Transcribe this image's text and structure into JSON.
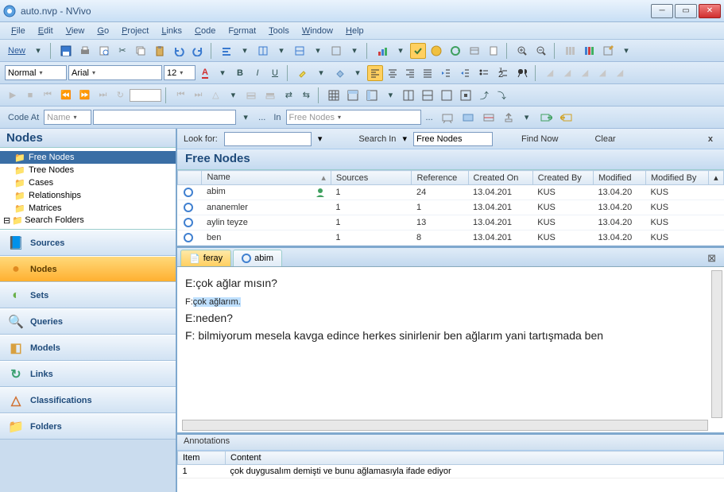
{
  "window": {
    "title": "auto.nvp - NVivo"
  },
  "menu": [
    "File",
    "Edit",
    "View",
    "Go",
    "Project",
    "Links",
    "Code",
    "Format",
    "Tools",
    "Window",
    "Help"
  ],
  "toolbar1": {
    "new": "New"
  },
  "toolbar2": {
    "style": "Normal",
    "font": "Arial",
    "size": "12"
  },
  "codebar": {
    "codeat": "Code At",
    "name": "Name",
    "in": "In",
    "freenodes": "Free Nodes",
    "ellipsis": "..."
  },
  "nav": {
    "header": "Nodes",
    "tree": [
      {
        "label": "Free Nodes",
        "sel": true
      },
      {
        "label": "Tree Nodes"
      },
      {
        "label": "Cases"
      },
      {
        "label": "Relationships"
      },
      {
        "label": "Matrices"
      },
      {
        "label": "Search Folders",
        "exp": true
      }
    ],
    "buttons": [
      {
        "label": "Sources",
        "icon": "📘",
        "c": "#3A7ACF"
      },
      {
        "label": "Nodes",
        "icon": "●",
        "active": true,
        "c": "#E08A20"
      },
      {
        "label": "Sets",
        "icon": "◐",
        "c": "#6AB04A"
      },
      {
        "label": "Queries",
        "icon": "🔍",
        "c": "#3A7ACF"
      },
      {
        "label": "Models",
        "icon": "◧",
        "c": "#D8A040"
      },
      {
        "label": "Links",
        "icon": "↻",
        "c": "#3AA070"
      },
      {
        "label": "Classifications",
        "icon": "△",
        "c": "#D07030"
      },
      {
        "label": "Folders",
        "icon": "📁",
        "c": "#E8B040"
      }
    ]
  },
  "search": {
    "lookfor": "Look for:",
    "searchin": "Search In",
    "target": "Free Nodes",
    "findnow": "Find Now",
    "clear": "Clear"
  },
  "list": {
    "header": "Free Nodes",
    "cols": [
      "Name",
      "Sources",
      "Reference",
      "Created On",
      "Created By",
      "Modified",
      "Modified By"
    ],
    "rows": [
      {
        "name": "abim",
        "sources": "1",
        "ref": "24",
        "con": "13.04.201",
        "cby": "KUS",
        "mod": "13.04.20",
        "mby": "KUS",
        "badge": true
      },
      {
        "name": "ananemler",
        "sources": "1",
        "ref": "1",
        "con": "13.04.201",
        "cby": "KUS",
        "mod": "13.04.20",
        "mby": "KUS"
      },
      {
        "name": "aylin teyze",
        "sources": "1",
        "ref": "13",
        "con": "13.04.201",
        "cby": "KUS",
        "mod": "13.04.20",
        "mby": "KUS"
      },
      {
        "name": "ben",
        "sources": "1",
        "ref": "8",
        "con": "13.04.201",
        "cby": "KUS",
        "mod": "13.04.20",
        "mby": "KUS"
      }
    ]
  },
  "tabs": [
    {
      "label": "feray",
      "icon": "📄",
      "active": true
    },
    {
      "label": "abim",
      "icon": "○"
    }
  ],
  "doc": {
    "l1": "E:çok ağlar mısın?",
    "l2a": "F:",
    "l2b": "çok ağlarım.",
    "l3": "E:neden?",
    "l4": "F: bilmiyorum mesela kavga edince herkes sinirlenir ben ağlarım yani tartışmada ben"
  },
  "anno": {
    "header": "Annotations",
    "cols": [
      "Item",
      "Content"
    ],
    "rows": [
      {
        "item": "1",
        "content": "çok duygusalım demişti ve bunu ağlamasıyla ifade ediyor"
      }
    ]
  }
}
